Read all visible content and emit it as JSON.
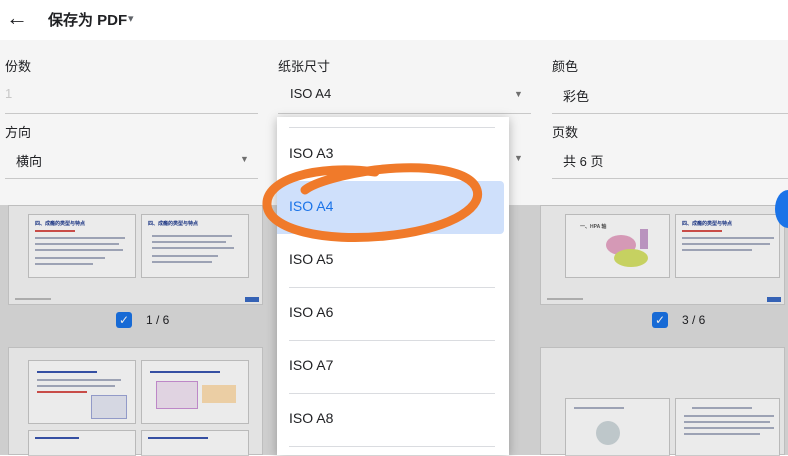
{
  "header": {
    "back_icon": "arrow-left-icon",
    "title": "保存为 PDF",
    "title_caret": "▾"
  },
  "settings": {
    "copies": {
      "label": "份数",
      "value": "1"
    },
    "paper_size": {
      "label": "纸张尺寸",
      "value": "ISO A4"
    },
    "color": {
      "label": "颜色",
      "value": "彩色"
    },
    "orientation": {
      "label": "方向",
      "value": "横向"
    },
    "pages": {
      "label": "页数",
      "value": "共 6 页"
    }
  },
  "dropdown": {
    "items": [
      "ISO A3",
      "ISO A4",
      "ISO A5",
      "ISO A6",
      "ISO A7",
      "ISO A8"
    ],
    "selected": "ISO A4"
  },
  "preview": {
    "pages": [
      {
        "number": "1 / 6",
        "checked": true,
        "titles": [
          "四、成瘾的类型与特点",
          "四、成瘾的类型与特点"
        ]
      },
      {
        "number": "3 / 6",
        "checked": true,
        "titles": [
          "一、HPA 轴",
          "四、成瘾的类型与特点"
        ]
      }
    ]
  },
  "colors": {
    "accent": "#1a73e8",
    "selection": "#cfe0fb",
    "annotation": "#f07a2a",
    "settings_bg": "#f5f5f5",
    "preview_bg": "#e0e0e0"
  }
}
